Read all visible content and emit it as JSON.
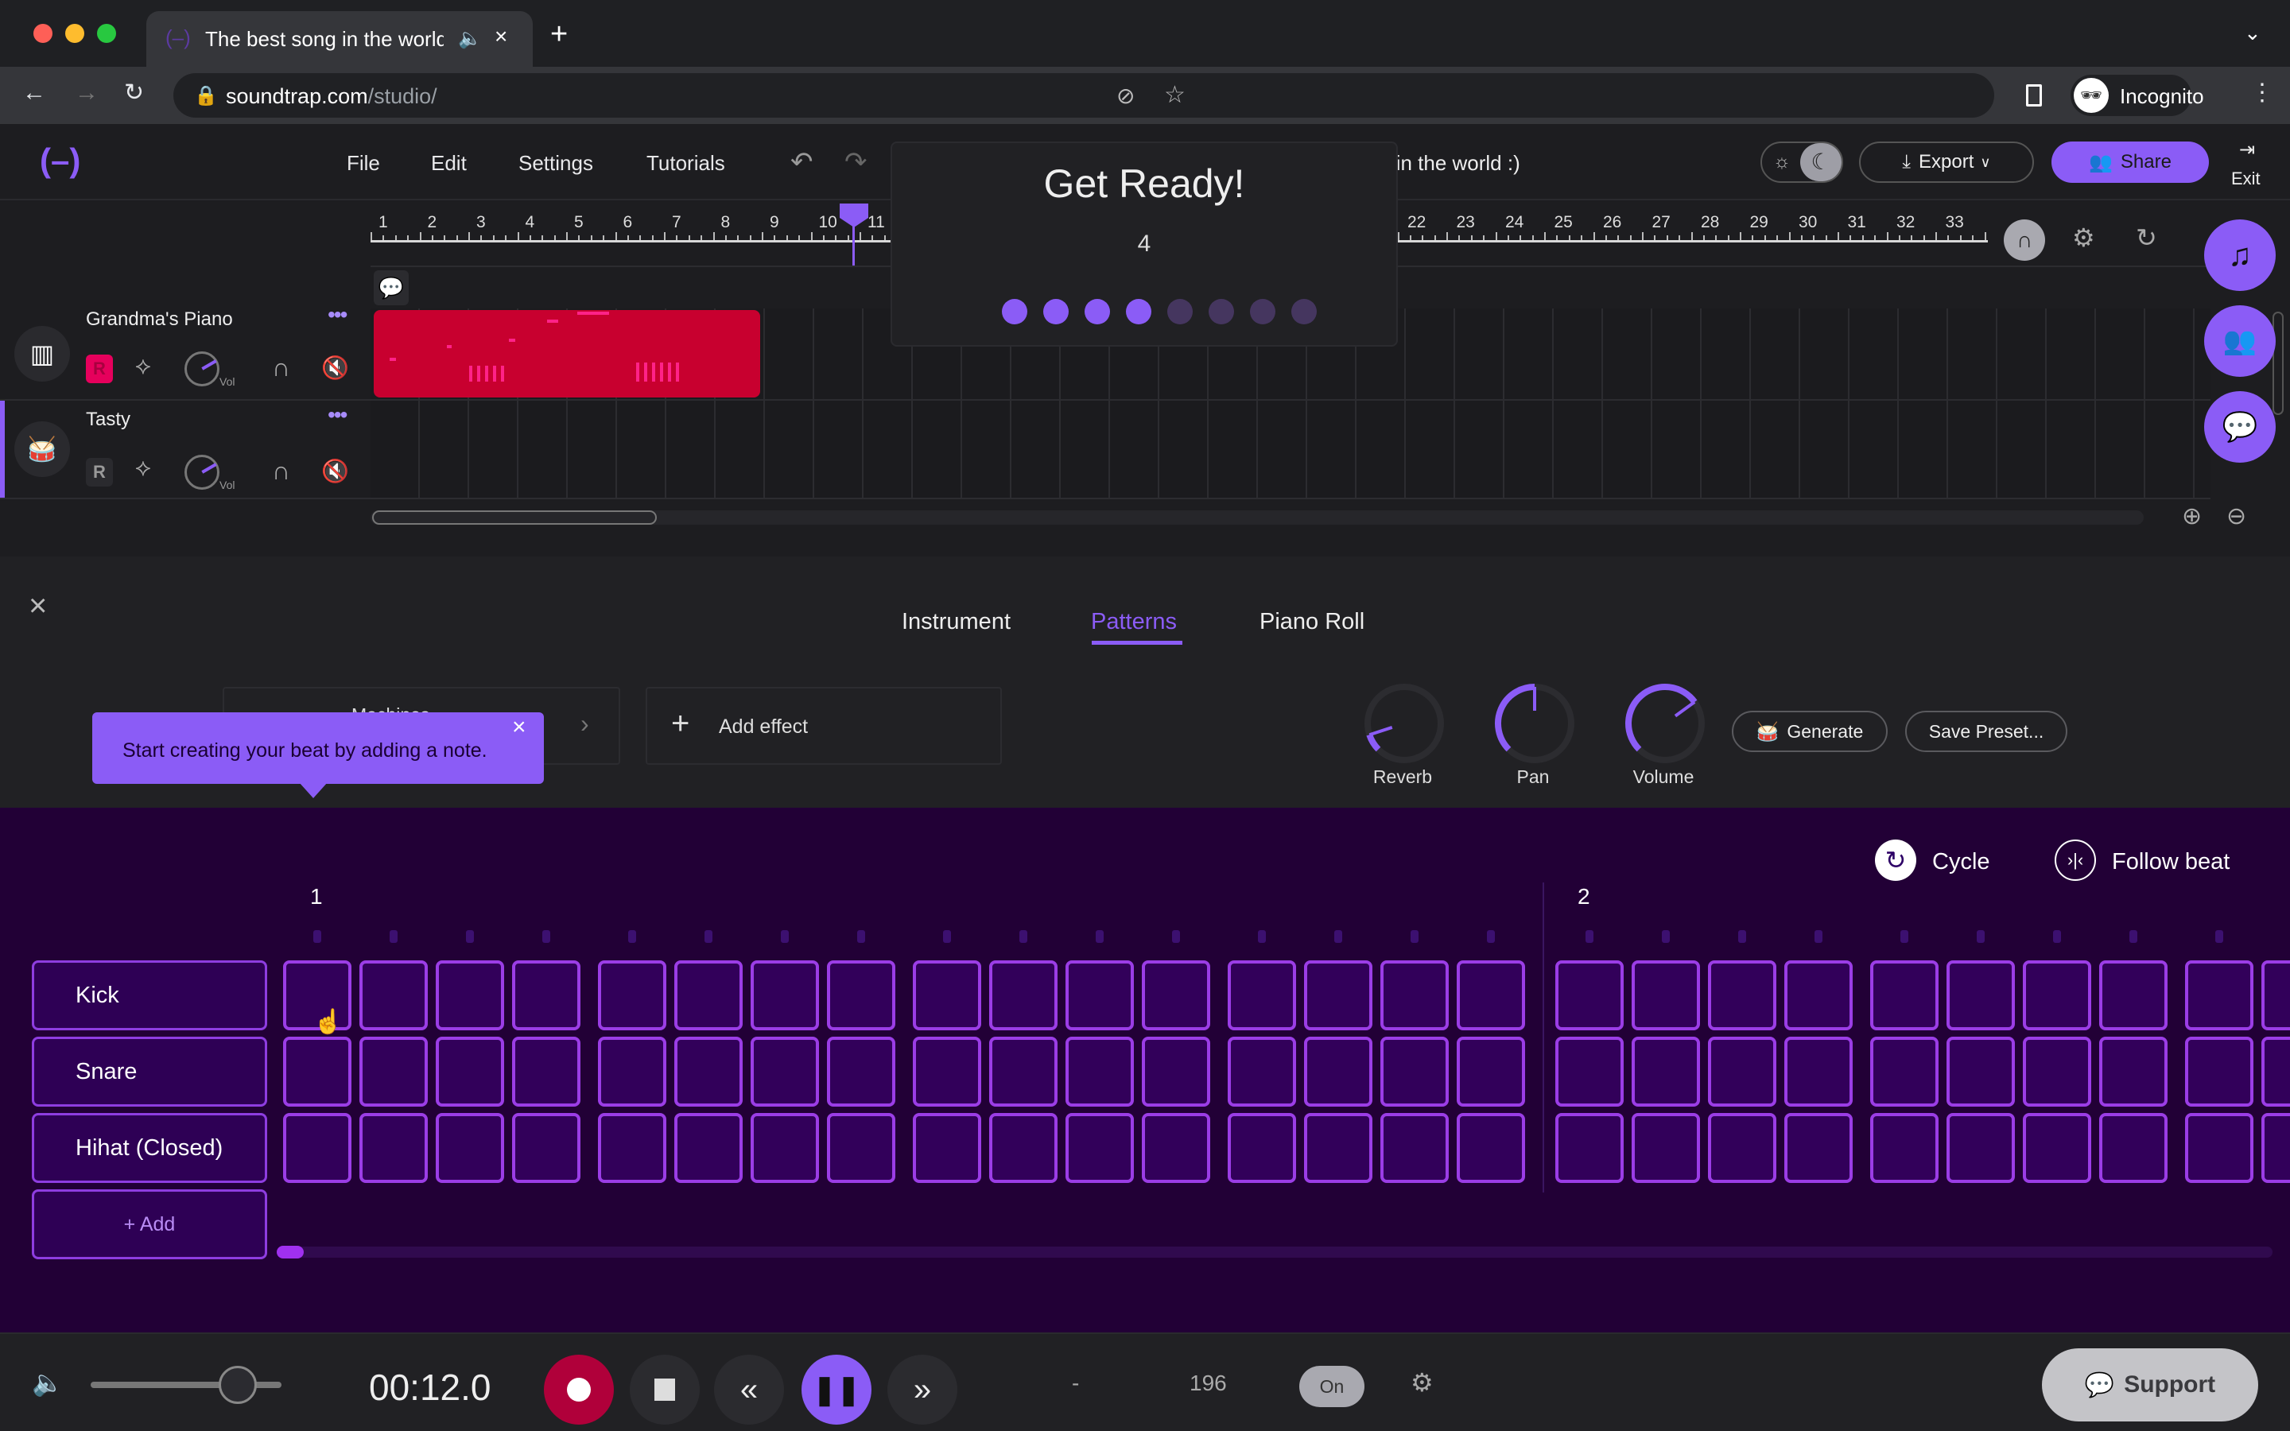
{
  "browser": {
    "tab_title": "The best song in the world",
    "url_host": "soundtrap.com",
    "url_path": "/studio/",
    "profile_label": "Incognito"
  },
  "header": {
    "menu": [
      "File",
      "Edit",
      "Settings",
      "Tutorials"
    ],
    "song_title_fragment": "g in the world :)",
    "export_label": "Export",
    "share_label": "Share",
    "exit_label": "Exit"
  },
  "ruler": {
    "bars_left": [
      "1",
      "2",
      "3",
      "4",
      "5",
      "6",
      "7",
      "8",
      "9",
      "10",
      "11"
    ],
    "bars_right": [
      "22",
      "23",
      "24",
      "25",
      "26",
      "27",
      "28",
      "29",
      "30",
      "31",
      "32",
      "33"
    ]
  },
  "get_ready": {
    "title": "Get Ready!",
    "count": "4",
    "beats_total": 8,
    "beats_done": 4
  },
  "tracks": [
    {
      "name": "Grandma's Piano",
      "type": "piano",
      "record_armed": true,
      "vol_label": "Vol",
      "region_color": "#c8002f"
    },
    {
      "name": "Tasty",
      "type": "drums",
      "record_armed": false,
      "vol_label": "Vol"
    }
  ],
  "editor": {
    "tabs": [
      "Instrument",
      "Patterns",
      "Piano Roll"
    ],
    "active_tab": "Patterns",
    "machine_label": "Machines",
    "add_effect_label": "Add effect",
    "knobs": [
      {
        "label": "Reverb",
        "value": 0.1
      },
      {
        "label": "Pan",
        "value": 0.5
      },
      {
        "label": "Volume",
        "value": 0.7
      }
    ],
    "generate_label": "Generate",
    "save_preset_label": "Save Preset...",
    "tooltip": "Start creating your beat by adding a note."
  },
  "beat_grid": {
    "cycle_label": "Cycle",
    "follow_label": "Follow beat",
    "bar_labels": [
      "1",
      "2"
    ],
    "rows": [
      "Kick",
      "Snare",
      "Hihat (Closed)"
    ],
    "add_label": "+  Add",
    "steps_visible": 26
  },
  "transport": {
    "time": "00:12.0",
    "key": "-",
    "tempo": "196",
    "metronome": "On",
    "support_label": "Support",
    "master_volume": 0.77
  },
  "colors": {
    "accent": "#8b5cf6",
    "record": "#b0003a",
    "grid_bg": "#220036",
    "cell_border": "#9b3de6"
  }
}
